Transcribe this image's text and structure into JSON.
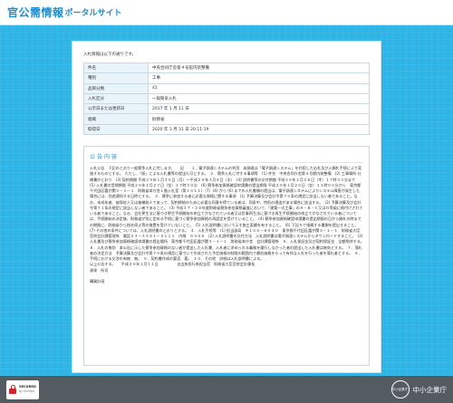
{
  "header": {
    "logo_main": "官公需情報",
    "logo_sub": "ポータルサイト"
  },
  "intro": "入札情報は以下の通りです。",
  "info_rows": [
    {
      "label": "件名",
      "value": "中央合同庁舎第４号館内装整備"
    },
    {
      "label": "種別",
      "value": "工事"
    },
    {
      "label": "品目分類",
      "value": "41"
    },
    {
      "label": "入札区分",
      "value": "一般競争入札"
    },
    {
      "label": "公示日または更新日",
      "value": "2017 年 1 月 11 日"
    },
    {
      "label": "組織",
      "value": "財務省"
    },
    {
      "label": "取得日",
      "value": "2020 年 3 月 31 日 20:11:19"
    }
  ],
  "notice": {
    "title": "公告内容",
    "body": "入札公告　下記のとおり一般競争入札に付します。　　記　　１．電子調達システムの利用　本調達は「電子調達システム」を利用した応札及び入開札手続により実施するものとする。　ただし、「紙」による入札書等の提出も可とする。　２．競争入札に付する事項等　(1) 件名　中央合同庁舎第４号館内装整備　(2) 工事場所 仕様書のとおり　(3) 契約期間 平成２９年１月３０日（月）～平成２９年３月８日（水）　(4) 説明書等の交付期間 平成２９年１月２６日（木）１７時３０分まで　(5) 入札書の受領期限 平成２９年１月２７日（金）１７時３０分　(6) 競争参加資格確認申請書の提出期限 平成２９年１月２０日（金）１１時００分から　東京都千代田区霞が関３－１－１　財務省本庁舎１階入札室（第１９１１）（7）(4) から (6) までの入札書類の提出は、電子調達システムによりシステム障害が発生した場合には、別途通知する日時とする。　３．競争に参加する者に必要な資格に関する事項　(1) 予算決算及び会計令第７０条の規定に該当しない者であること。なお、未成年者、被保佐人又は被補助人であって、契約締結のために必要な同意を得ている者は、同条中、特別の理由がある場合に該当する。　(2) 予算決算及び会計令第７１条の規定に該当しない者であること。　(3) 平成２７・２８年度財務省競争参加資格審査において、「建築一式工事」のＡ・Ｂ・Ｃ又はＤ等級に格付けされている者であること。なお、会社更生法に基づき更生手続開始の申立てがなされている者又は民事再生法に基づき再生手続開始の申立てがなされている者については、手続開始の決定後、財務省が別に定める手続に基づく競争参加資格の再認定を受けていること。　(4) 競争参加資格確認申請書の提出期限の日から開札の時までの期間に、財務省から指名停止等の措置を受けていないこと。　(5) 入札説明書において示す施工実績を有すること。　(6) 下記５で指摘する書類を提出すること。　(7) その他の条件については、入札説明書のとおりとする。　４．入札手続等　(1) 担当部局　〒１００－８９４０　東京都千代田区霞が関３－１－１　財務省大臣官房会計課管理係　電話０３－３５８１－４１１１　内線　５４５８　(2) 入札説明書の交付方法　入札説明書は電子調達システムからダウンロードすること。　(3) 入札書及び競争参加資格確認申請書の提出場所　東京都千代田区霞が関３－１－１　財務省本庁舎　会計課管理係　５．入札保証金及び契約保証金　全額免除する。　６．入札の無効　本公告に示した競争参加資格のない者が提出した入札書、入札者に求められる義務を履行しなかった者の提出した入札書は無効とする。　７．落札者の決定方法　予算決算及び会計令第７９条の規定に基づいて作成された予定価格の制限の範囲内で最低価格をもって有効な入札を行った者を落札者とする。　８．手続における交渉の有無　無。　９．契約書作成の要否　要。　１０．その他　詳細は入札説明書による。\n以上公告する。　　平成２９年１月１１日　　　　　支出負担行為担当官　財務省大臣官房会計課長\n源泉　所司\n\n購買計画"
  },
  "footer": {
    "seal_line1": "SECURED",
    "seal_line2": "by Sectigo",
    "brand_mark": "中小企業庁",
    "brand_name": "中小企業庁"
  }
}
